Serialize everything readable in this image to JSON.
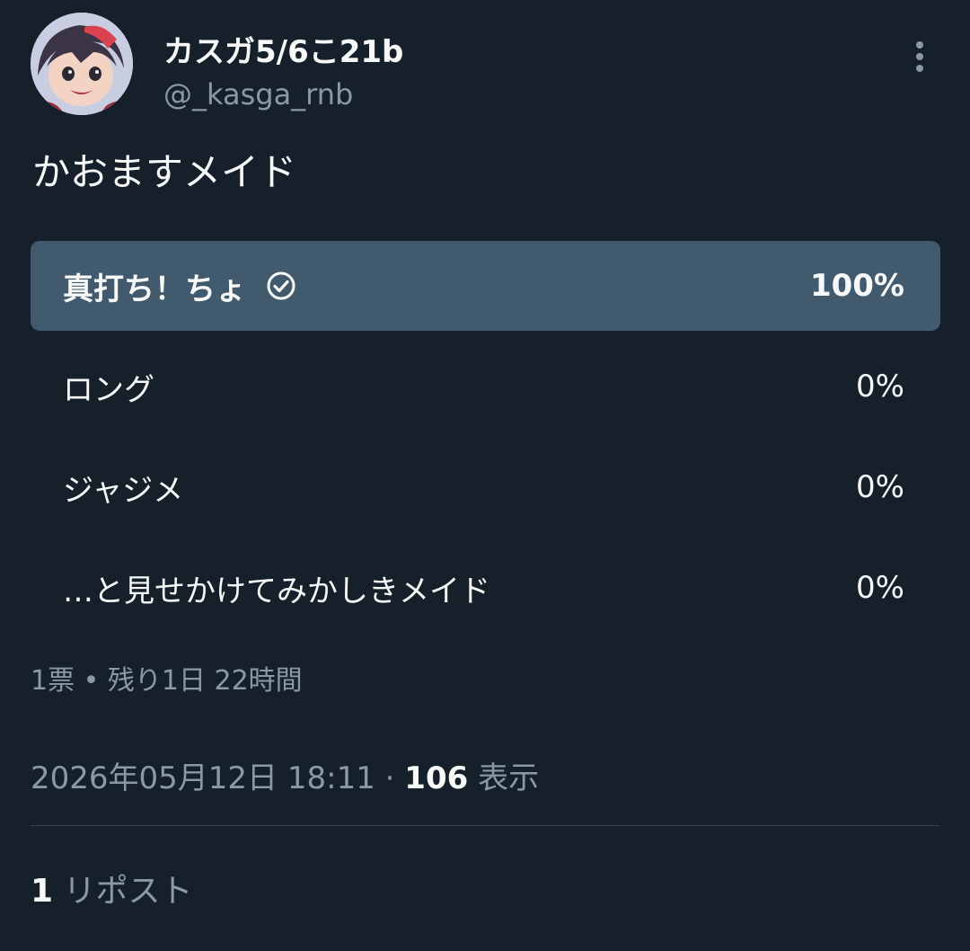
{
  "author": {
    "display_name": "カスガ5/6こ21b",
    "handle": "@_kasga_rnb",
    "avatar_icon": "avatar-icon"
  },
  "more_icon": "more-vertical-icon",
  "tweet": {
    "text": "かおますメイド"
  },
  "poll": {
    "options": [
      {
        "label": "真打ち！ちょ",
        "percent": "100%",
        "fill": 1.0,
        "winner": true
      },
      {
        "label": "ロング",
        "percent": "0%",
        "fill": 0.0,
        "winner": false
      },
      {
        "label": "ジャジメ",
        "percent": "0%",
        "fill": 0.0,
        "winner": false
      },
      {
        "label": "…と見せかけてみかしきメイド",
        "percent": "0%",
        "fill": 0.0,
        "winner": false
      }
    ],
    "meta": "1票 • 残り1日 22時間"
  },
  "timestamp": {
    "datetime": "2026年05月12日 18:11",
    "separator": " · ",
    "views_count": "106",
    "views_label": " 表示"
  },
  "stats": {
    "repost_count": "1",
    "repost_label": " リポスト"
  },
  "colors": {
    "background": "#15202b",
    "poll_fill": "#425a6e",
    "secondary_text": "#8b98a5"
  }
}
